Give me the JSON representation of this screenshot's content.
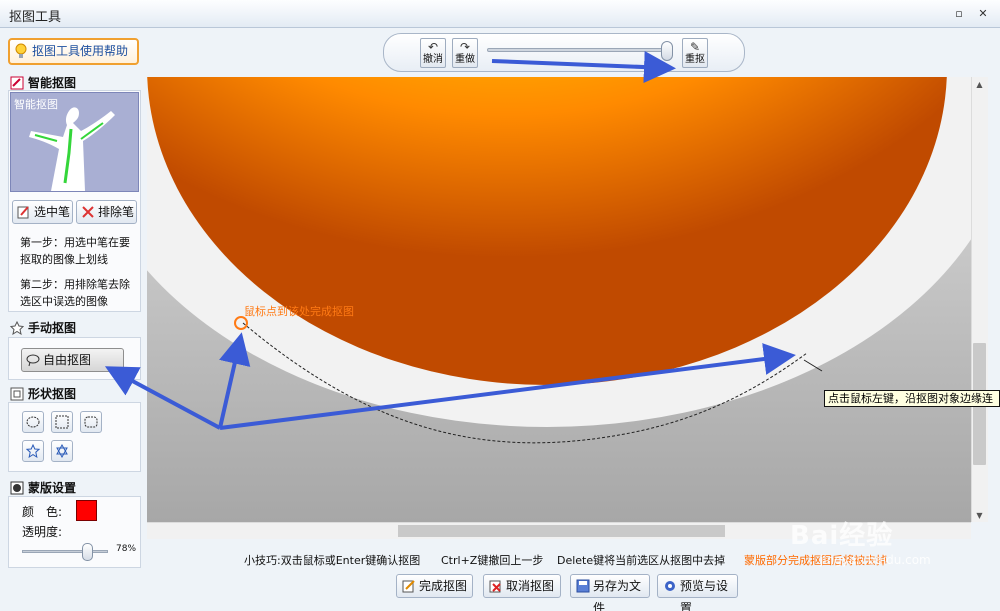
{
  "window": {
    "title": "抠图工具"
  },
  "help": {
    "label": "抠图工具使用帮助"
  },
  "smart": {
    "title": "智能抠图",
    "preview_label": "智能抠图",
    "select_pen": "选中笔",
    "exclude_pen": "排除笔",
    "step1": "第一步：用选中笔在要抠取的图像上划线",
    "step2": "第二步：用排除笔去除选区中误选的图像"
  },
  "manual": {
    "title": "手动抠图",
    "free_cut": "自由抠图"
  },
  "shape": {
    "title": "形状抠图"
  },
  "mask": {
    "title": "蒙版设置",
    "color_label": "颜　色:",
    "opacity_label": "透明度:",
    "opacity_value": "78%",
    "opacity_fraction": 0.78,
    "color": "#ff0000"
  },
  "toolbar": {
    "undo": "撤消",
    "redo": "重做",
    "recut": "重抠",
    "zoom_fraction": 0.95
  },
  "canvas": {
    "note": "鼠标点到该处完成抠图",
    "tooltip": "点击鼠标左键，沿抠图对象边缘连"
  },
  "tips": {
    "tip1": "小技巧:双击鼠标或Enter键确认抠图",
    "tip2": "Ctrl+Z键撤回上一步",
    "tip3": "Delete键将当前选区从抠图中去掉",
    "tip4": "蒙版部分完成抠图后将被去掉"
  },
  "actions": {
    "finish": "完成抠图",
    "cancel": "取消抠图",
    "save_as": "另存为文件",
    "preview_settings": "预览与设置"
  },
  "watermark": {
    "brand": "Bai经验",
    "url": "jingyan.baidu.com"
  }
}
